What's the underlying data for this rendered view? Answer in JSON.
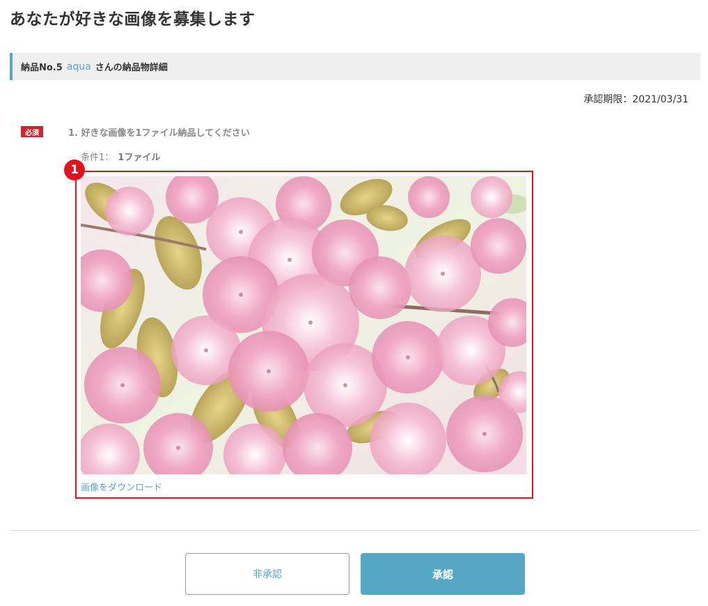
{
  "page": {
    "title": "あなたが好きな画像を募集します"
  },
  "section": {
    "prefix": "納品No.5",
    "user_name": "aqua",
    "suffix": "さんの納品物詳細"
  },
  "deadline": {
    "label": "承認期限：2021/03/31"
  },
  "question": {
    "required_label": "必須",
    "title": "1. 好きな画像を1ファイル納品してください",
    "condition_label": "条件1：",
    "condition_value": "1ファイル",
    "marker_number": "1",
    "image_alt": "桜の花の写真",
    "download_label": "画像をダウンロード"
  },
  "actions": {
    "reject_label": "非承認",
    "approve_label": "承認"
  },
  "colors": {
    "accent": "#56a6c6",
    "required_badge": "#c8282f",
    "highlight": "#e3101e"
  }
}
